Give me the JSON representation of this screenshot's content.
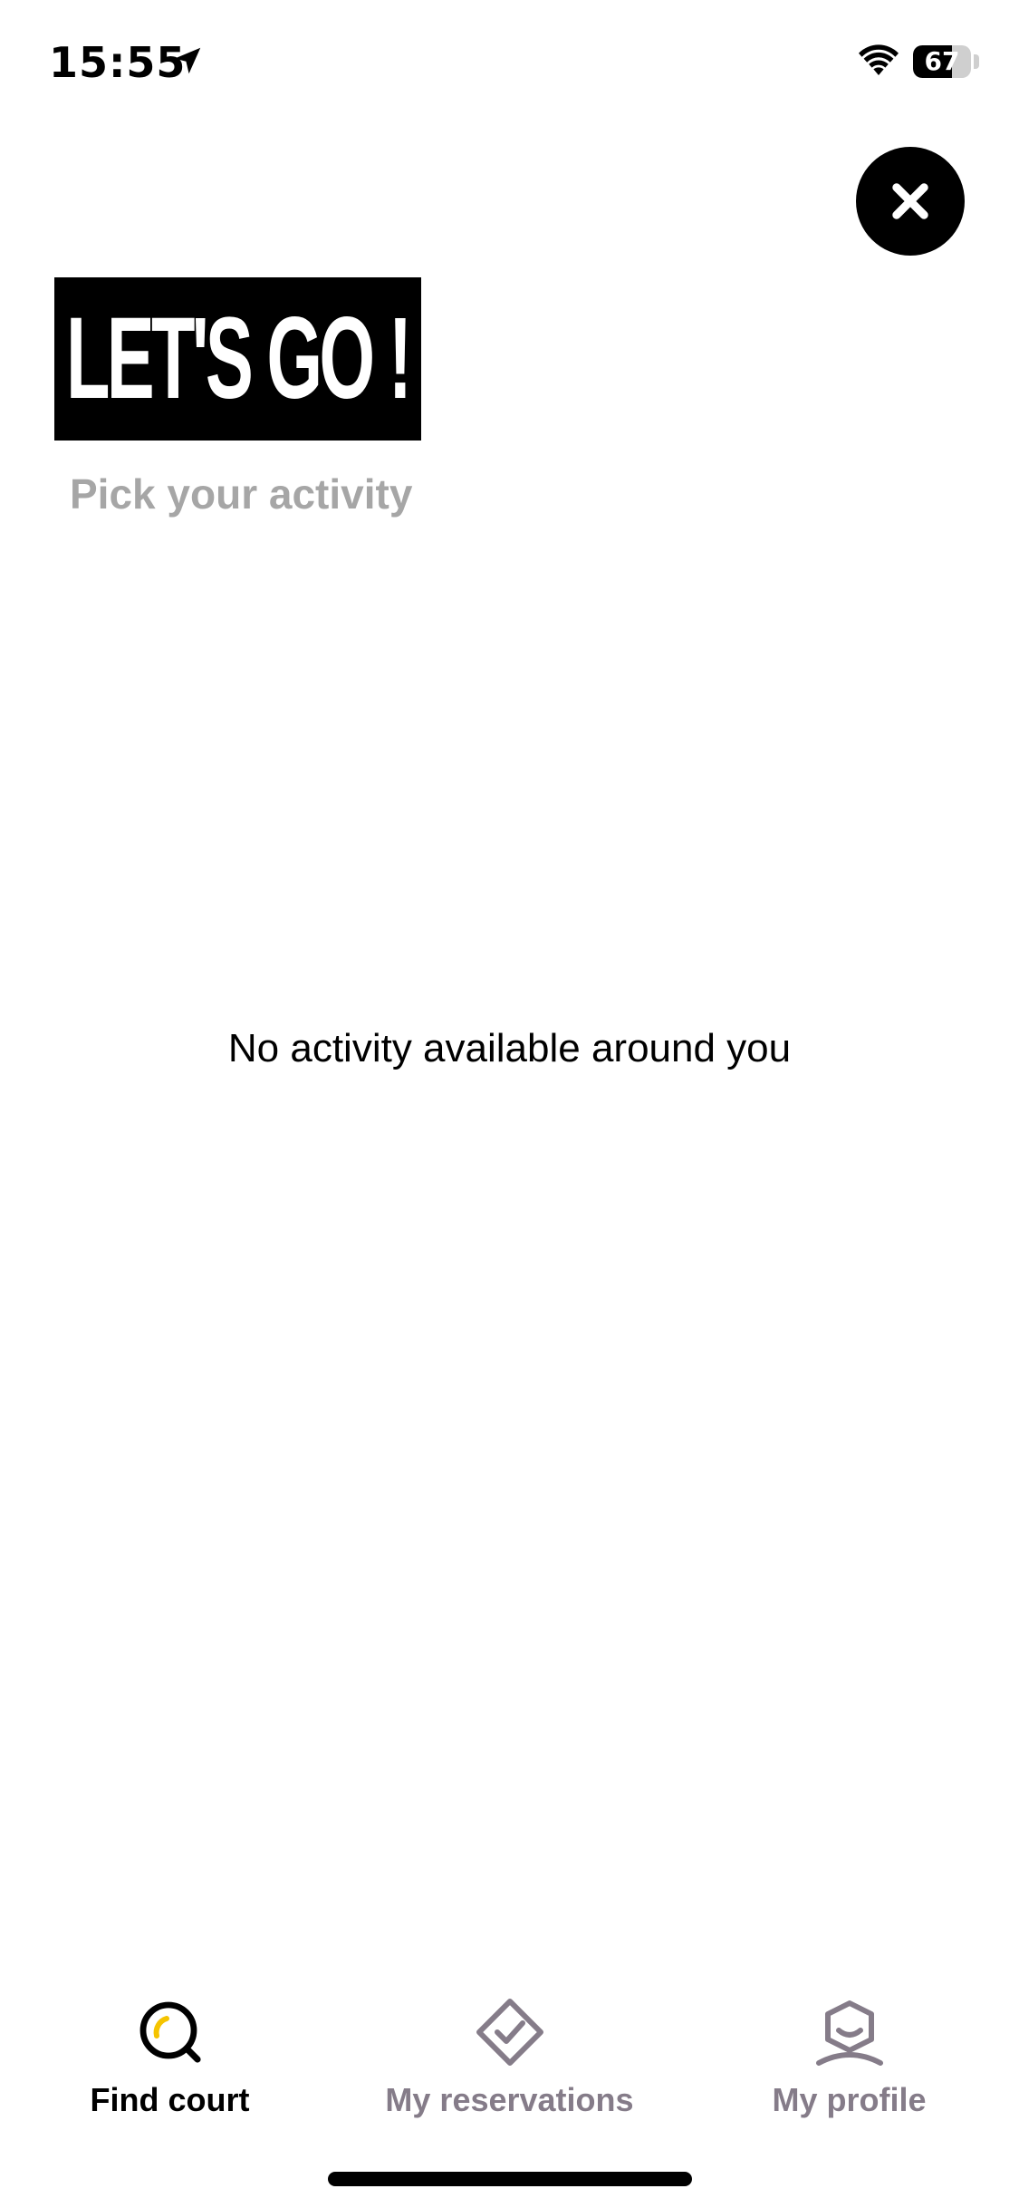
{
  "status_bar": {
    "time": "15:55",
    "battery_level": "67",
    "battery_fraction": 0.67
  },
  "header": {
    "title": "LET'S GO !",
    "subtitle": "Pick your activity"
  },
  "empty_state": {
    "message": "No activity available around you"
  },
  "tab_bar": {
    "tabs": [
      {
        "label": "Find court",
        "icon": "search-icon",
        "active": true
      },
      {
        "label": "My reservations",
        "icon": "ticket-check-icon",
        "active": false
      },
      {
        "label": "My profile",
        "icon": "profile-icon",
        "active": false
      }
    ]
  },
  "colors": {
    "active_label": "#000000",
    "inactive_label": "#857c89",
    "subtitle": "#a6a6a6",
    "accent_yellow": "#f5c400"
  }
}
